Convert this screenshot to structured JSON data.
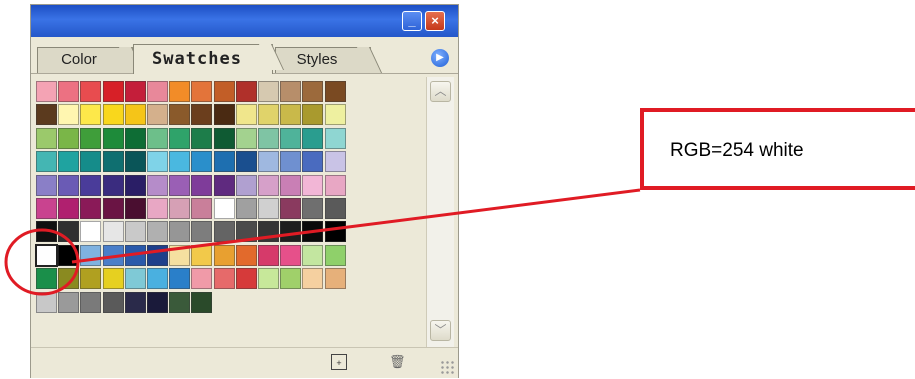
{
  "window": {
    "minimize_label": "_",
    "close_label": "×",
    "colors": {
      "title_bar": "#2457c9",
      "close_button": "#c5381a"
    }
  },
  "tabs": [
    {
      "label": "Color",
      "active": false
    },
    {
      "label": "Swatches",
      "active": true
    },
    {
      "label": "Styles",
      "active": false
    }
  ],
  "panel_menu_icon": "circle-arrow-right-icon",
  "footer": {
    "new_swatch_icon": "new-swatch-icon",
    "delete_icon": "trash-icon"
  },
  "scrollbar": {
    "up_icon": "chevron-up-icon",
    "down_icon": "chevron-down-icon"
  },
  "swatch_colors": [
    [
      "#f4a3b4",
      "#ec7182",
      "#e84c4f",
      "#d72027",
      "#c41e3a",
      "#e8889a",
      "#f28c28",
      "#e3743a",
      "#c25e27",
      "#b0302a",
      "#d6c9b0",
      "#b78e6a",
      "#9c6a3c",
      "#7a4a22"
    ],
    [
      "#5b3a1e",
      "#fff6b0",
      "#fde84a",
      "#f9d71c",
      "#f5c518",
      "#d4b08c",
      "#8a5a2b",
      "#6b3e1d",
      "#4a2a12",
      "#f0e68c",
      "#e0d36a",
      "#c9b94a",
      "#a99a2e",
      "#eef0a0"
    ],
    [
      "#9bc96b",
      "#7ab648",
      "#3f9e3a",
      "#1e8b3a",
      "#0e6d35",
      "#6dbf8a",
      "#2fa36a",
      "#1d7d4a",
      "#0f5a33",
      "#a3d28f",
      "#7fc4a4",
      "#4fb39a",
      "#2a9d8f",
      "#8fd6d2"
    ],
    [
      "#44b6b3",
      "#1fa3a0",
      "#158c8a",
      "#0f6f70",
      "#0a5558",
      "#7fd3e8",
      "#4ab8e0",
      "#2a8fcb",
      "#1e6fb0",
      "#1a4f8f",
      "#9fb8e0",
      "#6f90d0",
      "#4a6bbf",
      "#c9c3e6"
    ],
    [
      "#8a7fc7",
      "#6a5bb5",
      "#4a3c9a",
      "#3a2c7f",
      "#2a1e66",
      "#b58cc9",
      "#9a5fb5",
      "#7f3c9a",
      "#5f2a7f",
      "#b0a0d0",
      "#d6a0c9",
      "#c97fb5",
      "#f2b6d6",
      "#e8a7c4"
    ],
    [
      "#c9438f",
      "#b0206f",
      "#8a1a58",
      "#6a1444",
      "#4a0e30",
      "#e8a7c4",
      "#d6a0b5",
      "#c97f9a",
      "#ffffff",
      "#a0a0a0",
      "#d0d0d0",
      "#8a3a5f",
      "#6f6f6f",
      "#5a5a5a"
    ],
    [
      "#101010",
      "#303030",
      "#ffffff",
      "#e6e6e6",
      "#c9c9c9",
      "#b0b0b0",
      "#969696",
      "#7d7d7d",
      "#646464",
      "#4b4b4b",
      "#353535",
      "#1e1e1e",
      "#0a0a0a",
      "#000000"
    ],
    [
      "#fefefe",
      "#000000",
      "#7fb2e0",
      "#4a7fc9",
      "#2a5aaa",
      "#1e3f8a",
      "#f5e0a0",
      "#f2c94a",
      "#e8a030",
      "#e26a2c",
      "#d63a6a",
      "#e6508a",
      "#c3e6a0",
      "#8fd06a"
    ],
    [
      "#1a8f4a",
      "#8a8a20",
      "#b0a020",
      "#e6d020",
      "#7fc9d6",
      "#4ab0e0",
      "#2a7fc9",
      "#f09aa8",
      "#e66a6a",
      "#d63a3a",
      "#c7e89a",
      "#a0d06a",
      "#f5d0a0",
      "#e6b07a"
    ],
    [
      "#c8c8c8",
      "#9a9a9a",
      "#7a7a7a",
      "#5a5a5a",
      "#2a2a4a",
      "#1a1a3a",
      "#3a5a3a",
      "#2a4a2a"
    ]
  ],
  "selected_swatch": {
    "row": 7,
    "col": 0
  },
  "callout": {
    "label": "RGB=254 white"
  },
  "annotation_color": "#e01b24"
}
